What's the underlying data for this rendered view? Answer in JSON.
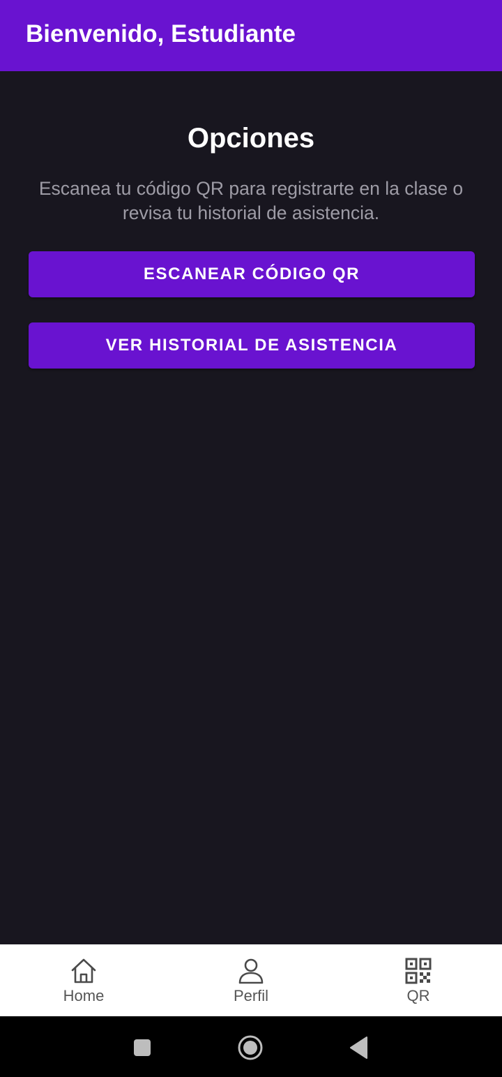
{
  "app_bar": {
    "title": "Bienvenido, Estudiante",
    "background_color": "#6913d0"
  },
  "main": {
    "heading": "Opciones",
    "description": "Escanea tu código QR para registrarte en la clase o revisa tu historial de asistencia.",
    "buttons": [
      {
        "label": "ESCANEAR CÓDIGO QR"
      },
      {
        "label": "VER HISTORIAL DE ASISTENCIA"
      }
    ],
    "background_color": "#18161f",
    "accent_color": "#6913d0"
  },
  "bottom_nav": {
    "items": [
      {
        "label": "Home",
        "icon": "home-icon"
      },
      {
        "label": "Perfil",
        "icon": "person-icon"
      },
      {
        "label": "QR",
        "icon": "qr-code-icon"
      }
    ]
  },
  "system_nav": {
    "buttons": [
      "recent-apps-icon",
      "home-circle-icon",
      "back-triangle-icon"
    ]
  }
}
